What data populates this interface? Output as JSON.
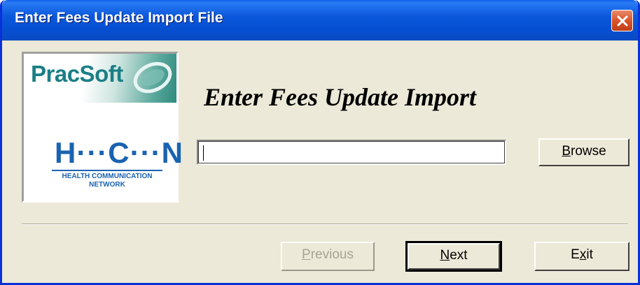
{
  "window": {
    "title": "Enter Fees Update Import File",
    "close_icon": "close-icon"
  },
  "logo": {
    "brand": "PracSoft",
    "partner_mark": "H···C···N",
    "partner_line1": "HEALTH COMMUNICATION",
    "partner_line2": "NETWORK"
  },
  "main": {
    "heading": "Enter Fees Update Import",
    "file_path_value": ""
  },
  "buttons": {
    "browse_mnemonic": "B",
    "browse_rest": "rowse",
    "previous_mnemonic": "P",
    "previous_rest": "revious",
    "next_mnemonic": "N",
    "next_rest": "ext",
    "exit_pre": "E",
    "exit_mnemonic": "x",
    "exit_post": "it"
  },
  "colors": {
    "titlebar": "#0a5ee8",
    "face": "#ece9d8",
    "close": "#d8542c",
    "hcn_blue": "#1a63b0",
    "pracsoft_teal": "#1b7f86"
  }
}
